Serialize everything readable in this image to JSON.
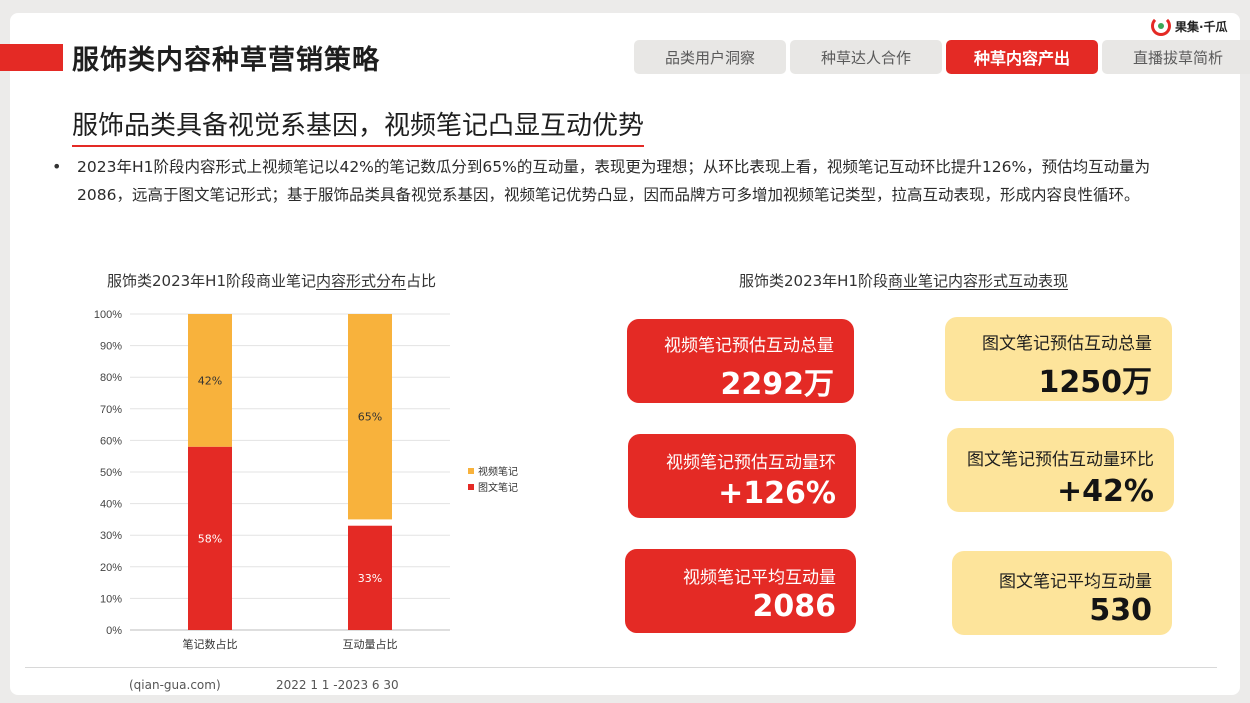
{
  "brand": {
    "name": "果集·千瓜",
    "accent": "#e42a25",
    "secondary": "#f8b23c",
    "card_yellow": "#fde49b"
  },
  "page_title": "服饰类内容种草营销策略",
  "tabs": [
    {
      "label": "品类用户洞察",
      "active": false
    },
    {
      "label": "种草达人合作",
      "active": false
    },
    {
      "label": "种草内容产出",
      "active": true
    },
    {
      "label": "直播拔草简析",
      "active": false
    }
  ],
  "subtitle": "服饰品类具备视觉系基因，视频笔记凸显互动优势",
  "bullet": "2023年H1阶段内容形式上视频笔记以42%的笔记数瓜分到65%的互动量，表现更为理想；从环比表现上看，视频笔记互动环比提升126%，预估均互动量为2086，远高于图文笔记形式；基于服饰品类具备视觉系基因，视频笔记优势凸显，因而品牌方可多增加视频笔记类型，拉高互动表现，形成内容良性循环。",
  "left_title": {
    "pre": "服饰类2023年H1阶段商业笔记",
    "ul": "内容形式分布",
    "post": "占比"
  },
  "right_title": {
    "pre": "服饰类2023年H1阶段",
    "ul": "商业笔记内容形式互动表现",
    "post": ""
  },
  "chart_data": {
    "type": "bar",
    "stacked": true,
    "categories": [
      "笔记数占比",
      "互动量占比"
    ],
    "series": [
      {
        "name": "视频笔记",
        "values": [
          42,
          65
        ],
        "labels": [
          "42%",
          "65%"
        ],
        "color": "#f8b23c"
      },
      {
        "name": "图文笔记",
        "values": [
          58,
          33
        ],
        "labels": [
          "58%",
          "33%"
        ],
        "color": "#e42a25"
      }
    ],
    "yticks": [
      "0%",
      "10%",
      "20%",
      "30%",
      "40%",
      "50%",
      "60%",
      "70%",
      "80%",
      "90%",
      "100%"
    ],
    "ylim": [
      0,
      100
    ],
    "legend": "right"
  },
  "cards": [
    {
      "label": "视频笔记预估互动总量",
      "value": "2292万",
      "style": "red"
    },
    {
      "label": "图文笔记预估互动总量",
      "value": "1250万",
      "style": "yellow"
    },
    {
      "label": "视频笔记预估互动量环",
      "value": "+126%",
      "style": "red"
    },
    {
      "label": "图文笔记预估互动量环比",
      "value": "+42%",
      "style": "yellow"
    },
    {
      "label": "视频笔记平均互动量",
      "value": "2086",
      "style": "red"
    },
    {
      "label": "图文笔记平均互动量",
      "value": "530",
      "style": "yellow"
    }
  ],
  "footer": {
    "source": "(qian-gua.com)",
    "date": "2022   1   1   -2023   6   30"
  }
}
